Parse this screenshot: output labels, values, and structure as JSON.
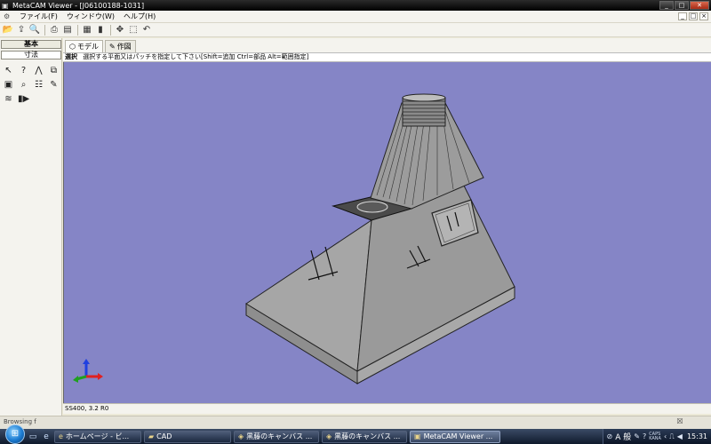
{
  "window": {
    "title": "MetaCAM Viewer - [J06100188-1031]",
    "app_icon": "metacam-icon",
    "minimize": "_",
    "maximize": "□",
    "close": "✕"
  },
  "menu": {
    "items": [
      "ファイル(F)",
      "ウィンドウ(W)",
      "ヘルプ(H)"
    ],
    "mdi_minimize": "_",
    "mdi_restore": "□",
    "mdi_close": "×"
  },
  "toolbar": {
    "buttons": [
      "open-icon",
      "import-icon",
      "print-preview-icon",
      "print-icon",
      "print-setup-icon",
      "properties-icon",
      "document-icon",
      "pan-icon",
      "zoom-window-icon",
      "zoom-undo-icon"
    ]
  },
  "left_panel": {
    "tabs": [
      "基本",
      "寸法"
    ],
    "tools": [
      "select-arrow-icon",
      "select-query-icon",
      "measure-icon",
      "layer-icon",
      "info-icon",
      "zoom-icon",
      "tree-icon",
      "note-icon",
      "layers-icon",
      "play-icon"
    ]
  },
  "view_tabs": [
    {
      "label": "モデル",
      "icon": "model-icon"
    },
    {
      "label": "作図",
      "icon": "drawing-icon"
    }
  ],
  "hint": {
    "mode": "選択",
    "text": "選択する平面又はパッチを指定して下さい[Shift=追加 Ctrl=部品 Alt=範囲指定]"
  },
  "status": {
    "material": "SS400, 3.2 R0"
  },
  "outer_status": {
    "text": "Browsing f",
    "close": "☒"
  },
  "taskbar": {
    "tasks": [
      {
        "label": "ホームページ - ビ...",
        "icon": "ie-icon",
        "active": false
      },
      {
        "label": "CAD",
        "icon": "folder-icon",
        "active": false
      },
      {
        "label": "黒藤のキャンバス ...",
        "icon": "browser-icon",
        "active": false
      },
      {
        "label": "黒藤のキャンバス ...",
        "icon": "browser-icon",
        "active": false
      },
      {
        "label": "MetaCAM Viewer ...",
        "icon": "metacam-icon",
        "active": true
      }
    ],
    "ime": "A 般",
    "caps": "CAPS",
    "kana": "KANA",
    "clock": "15:31"
  },
  "colors": {
    "viewport_bg": "#8585c6",
    "part_face": "#9b9b9b",
    "part_face_light": "#b3b3b3",
    "axis_x": "#e02020",
    "axis_y": "#20a020",
    "axis_z": "#2040e0"
  }
}
